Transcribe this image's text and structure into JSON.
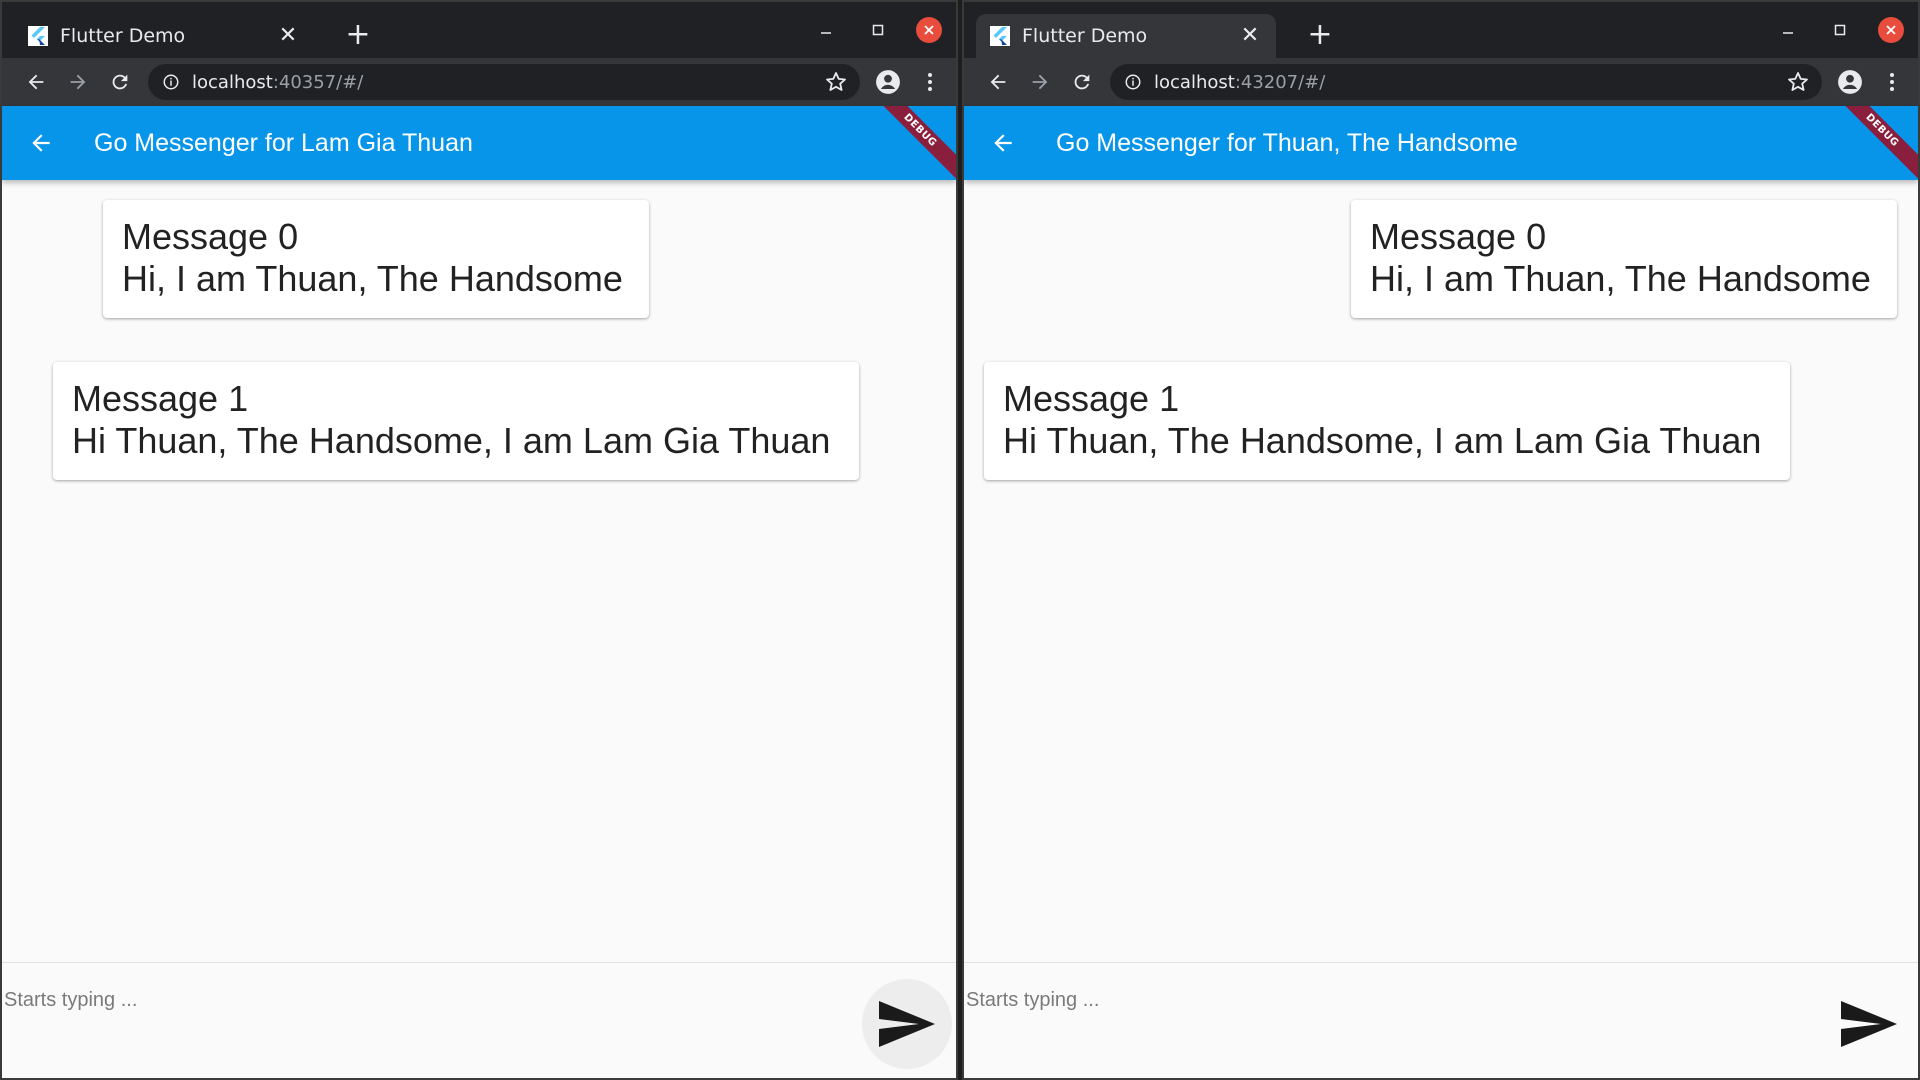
{
  "windows": [
    {
      "tab_title": "Flutter Demo",
      "url_host": "localhost",
      "url_rest": ":40357/#/",
      "app_title": "Go Messenger for Lam Gia Thuan",
      "debug_label": "DEBUG",
      "messages": [
        {
          "title": "Message 0",
          "text": "Hi, I am Thuan, The Handsome"
        },
        {
          "title": "Message 1",
          "text": "Hi Thuan, The Handsome, I am Lam Gia Thuan"
        }
      ],
      "input_placeholder": "Starts typing ..."
    },
    {
      "tab_title": "Flutter Demo",
      "url_host": "localhost",
      "url_rest": ":43207/#/",
      "app_title": "Go Messenger for Thuan, The Handsome",
      "debug_label": "DEBUG",
      "messages": [
        {
          "title": "Message 0",
          "text": "Hi, I am Thuan, The Handsome"
        },
        {
          "title": "Message 1",
          "text": "Hi Thuan, The Handsome, I am Lam Gia Thuan"
        }
      ],
      "input_placeholder": "Starts typing ..."
    }
  ],
  "colors": {
    "appbar": "#0795ea",
    "chrome_frame": "#202124",
    "chrome_toolbar": "#35363a",
    "debug_banner": "#8a1f3d",
    "close_button": "#e74c3c"
  },
  "icons": [
    "flutter-logo-icon",
    "close-icon",
    "plus-icon",
    "minimize-icon",
    "maximize-icon",
    "back-arrow-icon",
    "forward-arrow-icon",
    "reload-icon",
    "info-icon",
    "star-icon",
    "account-icon",
    "more-vert-icon",
    "send-icon"
  ]
}
